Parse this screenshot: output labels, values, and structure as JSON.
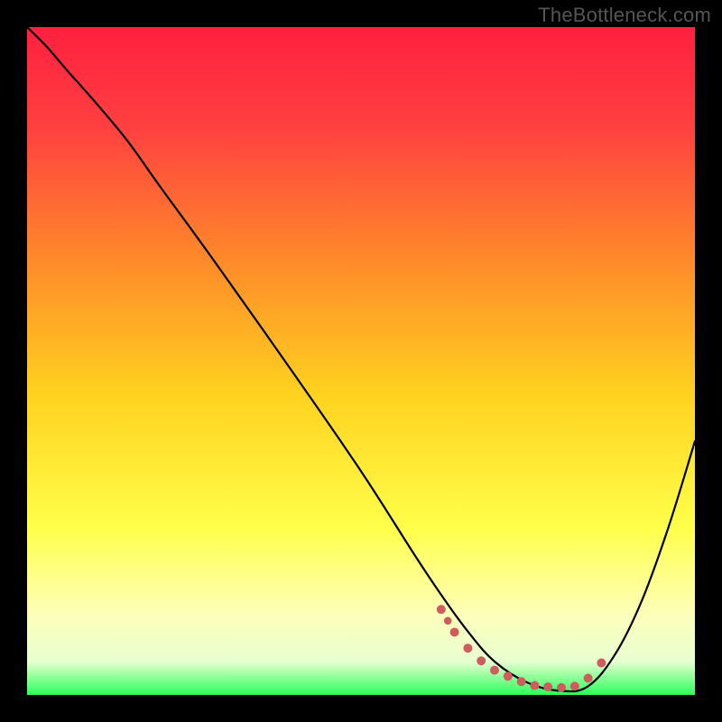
{
  "watermark": "TheBottleneck.com",
  "chart_data": {
    "type": "line",
    "title": "",
    "xlabel": "",
    "ylabel": "",
    "xlim": [
      0,
      100
    ],
    "ylim": [
      0,
      100
    ],
    "grid": false,
    "legend": false,
    "gradient_stops": [
      {
        "offset": 0.0,
        "color": "#ff1f3f"
      },
      {
        "offset": 0.15,
        "color": "#ff4040"
      },
      {
        "offset": 0.35,
        "color": "#ff8a2a"
      },
      {
        "offset": 0.55,
        "color": "#ffd21f"
      },
      {
        "offset": 0.75,
        "color": "#ffff4a"
      },
      {
        "offset": 0.88,
        "color": "#fdffba"
      },
      {
        "offset": 0.95,
        "color": "#e8ffd0"
      },
      {
        "offset": 1.0,
        "color": "#2aff5a"
      }
    ],
    "series": [
      {
        "name": "bottleneck-curve",
        "stroke": "#000000",
        "stroke_width": 2.2,
        "x": [
          0.0,
          3.0,
          6.0,
          10.0,
          15.0,
          20.0,
          28.0,
          40.0,
          50.0,
          58.0,
          62.0,
          66.0,
          70.0,
          75.0,
          80.0,
          84.0,
          88.0,
          92.0,
          96.0,
          100.0
        ],
        "values": [
          100.0,
          97.0,
          93.5,
          89.0,
          83.0,
          76.0,
          65.0,
          48.0,
          33.5,
          21.0,
          15.0,
          9.5,
          5.0,
          1.8,
          0.6,
          1.3,
          6.0,
          14.0,
          25.0,
          38.0
        ]
      },
      {
        "name": "optimal-band",
        "type": "dotted-band",
        "stroke": "#cf5d5d",
        "stroke_width": 5,
        "dot_spacing": 3.5,
        "x": [
          62.0,
          64.0,
          66.0,
          68.0,
          70.0,
          72.0,
          74.0,
          76.0,
          78.0,
          80.0,
          82.0,
          84.0,
          86.0
        ],
        "values": [
          12.8,
          9.4,
          7.0,
          5.1,
          3.7,
          2.8,
          2.0,
          1.4,
          1.2,
          1.1,
          1.3,
          2.5,
          4.8
        ]
      }
    ]
  }
}
